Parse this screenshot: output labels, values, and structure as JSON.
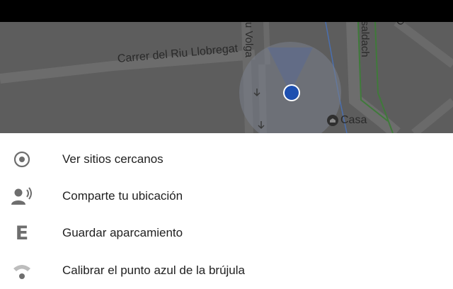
{
  "map": {
    "street_riu": "Carrer del Riu Llobregat",
    "street_volga": "u Volga",
    "street_casaldach": "saldach",
    "street_ca": "Ca",
    "place_label": "Casa",
    "place_icon": "home-pin-icon",
    "location_icon": "blue-dot-location-icon"
  },
  "menu": {
    "items": [
      {
        "label": "Ver sitios cercanos",
        "icon": "target-icon"
      },
      {
        "label": "Comparte tu ubicación",
        "icon": "share-location-person-icon"
      },
      {
        "label": "Guardar aparcamiento",
        "icon": "parking-e-icon"
      },
      {
        "label": "Calibrar el punto azul de la brújula",
        "icon": "wifi-signal-icon"
      }
    ]
  },
  "colors": {
    "location_dot": "#1d4fb0",
    "icon_gray": "#6e6e6e",
    "map_background": "#5d5d5d",
    "status_bar": "#000000"
  }
}
